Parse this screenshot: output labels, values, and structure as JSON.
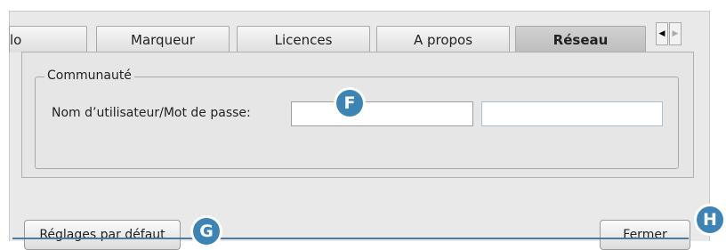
{
  "tabs": [
    {
      "label": "lo",
      "active": false
    },
    {
      "label": "Marqueur",
      "active": false
    },
    {
      "label": "Licences",
      "active": false
    },
    {
      "label": "A propos",
      "active": false
    },
    {
      "label": "Réseau",
      "active": true
    }
  ],
  "tab_scroll": {
    "left_icon": "triangle-left-icon",
    "right_icon": "triangle-right-icon",
    "left_glyph": "◀",
    "right_glyph": "▶"
  },
  "community": {
    "group_title": "Communauté",
    "credentials_label": "Nom d’utilisateur/Mot de passe:",
    "username_value": "",
    "password_value": ""
  },
  "buttons": {
    "defaults": "Réglages par défaut",
    "close": "Fermer"
  },
  "markers": [
    "F",
    "G",
    "H"
  ],
  "colors": {
    "accent": "#3b84b5",
    "active_tab": "#c8c8c8",
    "window_bg": "#e9e9e9"
  }
}
